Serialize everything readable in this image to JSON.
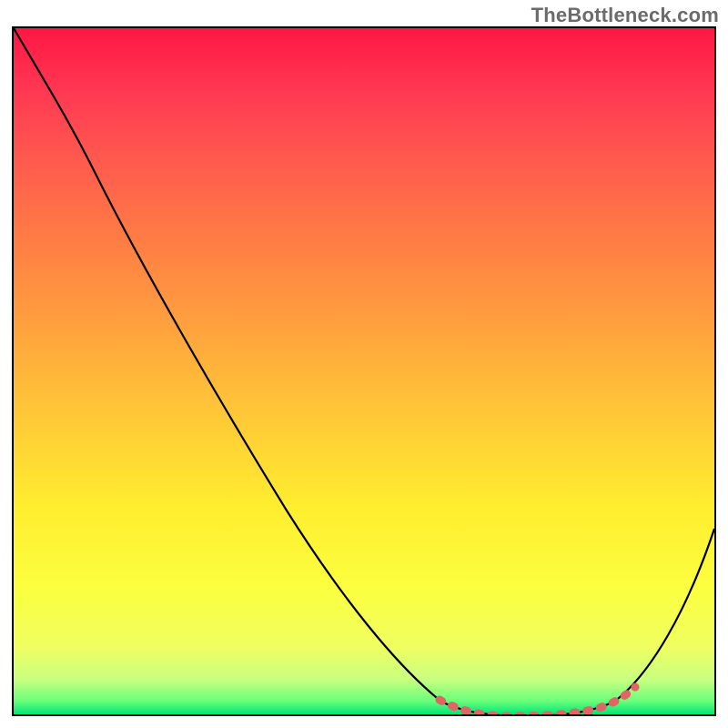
{
  "watermark": "TheBottleneck.com",
  "chart_data": {
    "type": "line",
    "title": "",
    "xlabel": "",
    "ylabel": "",
    "xlim": [
      0,
      100
    ],
    "ylim": [
      0,
      100
    ],
    "grid": false,
    "legend": false,
    "series": [
      {
        "name": "bottleneck-curve",
        "stroke": "#000000",
        "x": [
          0,
          5,
          10,
          15,
          20,
          25,
          30,
          35,
          40,
          45,
          50,
          55,
          60,
          62,
          65,
          68,
          72,
          76,
          80,
          84,
          88,
          92,
          96,
          100
        ],
        "y": [
          100,
          94,
          87,
          79,
          71,
          63,
          55,
          47,
          39,
          31,
          23,
          16,
          10,
          6,
          3,
          1,
          0,
          0,
          1,
          3,
          7,
          13,
          20,
          28
        ]
      },
      {
        "name": "highlight-dots",
        "stroke": "#e06666",
        "style": "dotted",
        "x": [
          61,
          63,
          65,
          67,
          69,
          71,
          73,
          75,
          77,
          79,
          81,
          83,
          85,
          87,
          89
        ],
        "y": [
          6,
          4,
          3,
          2,
          1,
          0,
          0,
          0,
          0,
          1,
          1,
          2,
          3,
          4,
          5
        ]
      }
    ],
    "gradient_stops": [
      {
        "pos": 0.0,
        "color": "#ff1744"
      },
      {
        "pos": 0.1,
        "color": "#ff3b53"
      },
      {
        "pos": 0.2,
        "color": "#ff5c4d"
      },
      {
        "pos": 0.3,
        "color": "#ff7a45"
      },
      {
        "pos": 0.4,
        "color": "#ff9740"
      },
      {
        "pos": 0.5,
        "color": "#ffb53a"
      },
      {
        "pos": 0.6,
        "color": "#ffd235"
      },
      {
        "pos": 0.7,
        "color": "#ffee2f"
      },
      {
        "pos": 0.82,
        "color": "#fbff40"
      },
      {
        "pos": 0.9,
        "color": "#f0ff60"
      },
      {
        "pos": 0.95,
        "color": "#c8ff80"
      },
      {
        "pos": 0.98,
        "color": "#6bff7a"
      },
      {
        "pos": 1.0,
        "color": "#00e676"
      }
    ],
    "annotations": []
  },
  "colors": {
    "curve": "#000000",
    "highlight": "#e06666",
    "border": "#000000",
    "watermark": "#6b6b6b"
  }
}
